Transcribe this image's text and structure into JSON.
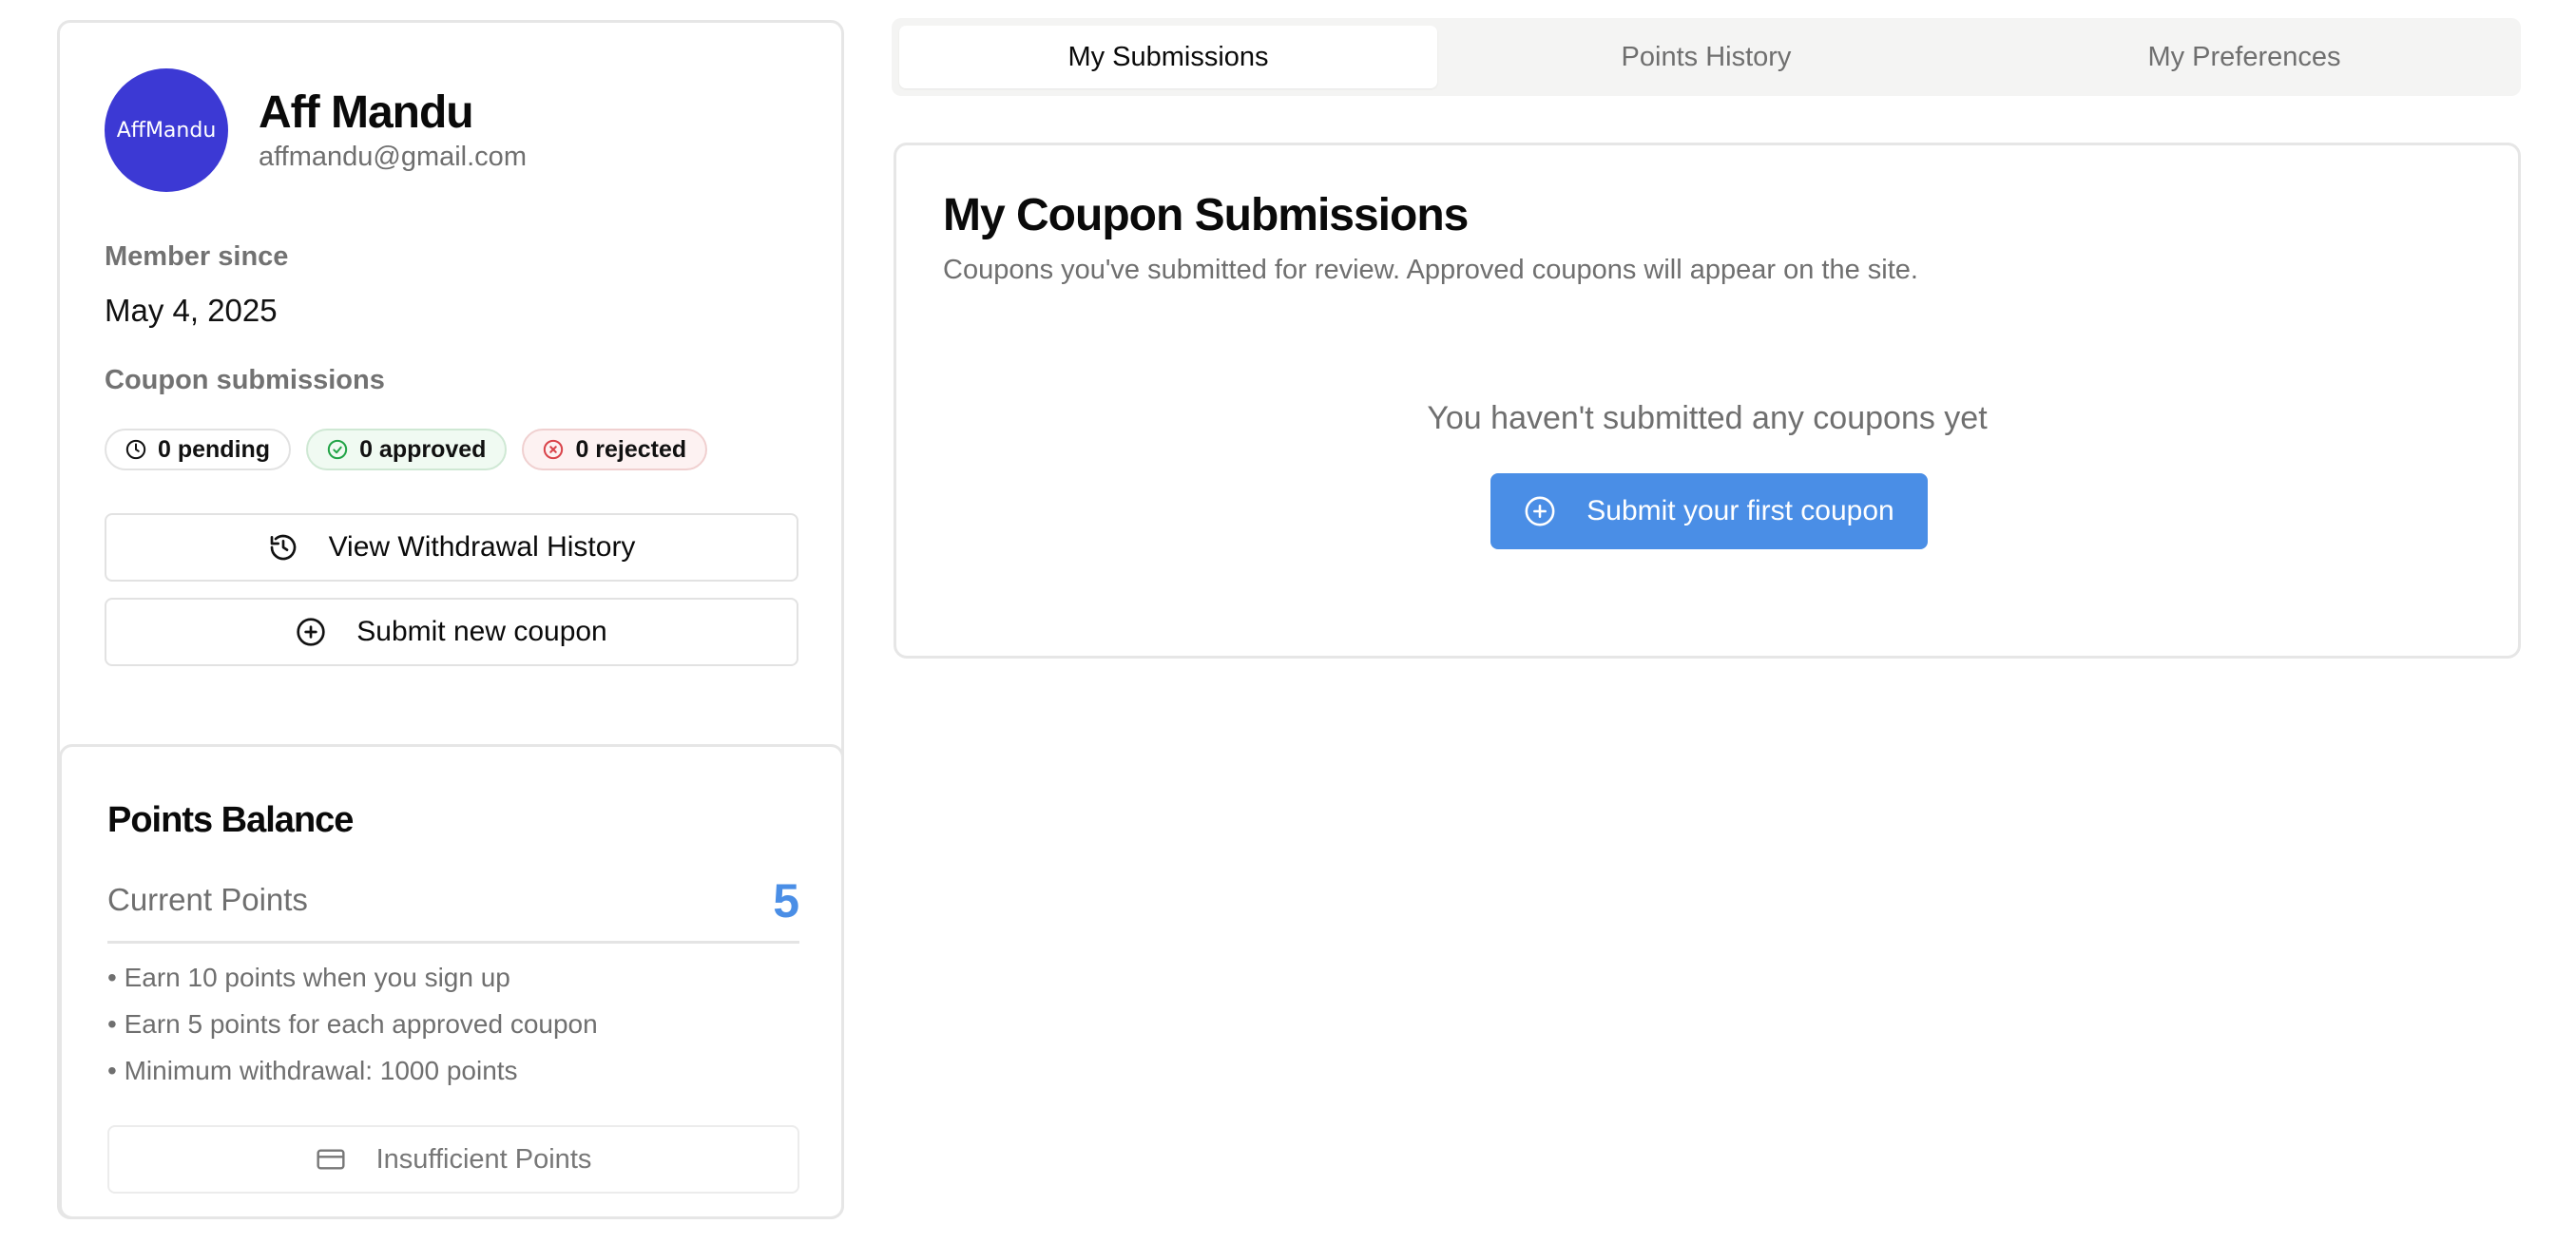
{
  "profile": {
    "avatar_text": "AffMandu",
    "name": "Aff Mandu",
    "email": "affmandu@gmail.com",
    "member_since_label": "Member since",
    "member_since_value": "May 4, 2025",
    "coupon_submissions_label": "Coupon submissions",
    "badges": {
      "pending": "0 pending",
      "approved": "0 approved",
      "rejected": "0 rejected"
    },
    "buttons": {
      "withdrawal_history": "View Withdrawal History",
      "submit_new_coupon": "Submit new coupon"
    },
    "icons": {
      "pending": "clock-icon",
      "approved": "check-circle-icon",
      "rejected": "x-circle-icon",
      "withdrawal_history": "history-icon",
      "submit_new_coupon": "plus-circle-icon"
    }
  },
  "points": {
    "title": "Points Balance",
    "current_label": "Current Points",
    "current_value": "5",
    "rules": [
      "• Earn 10 points when you sign up",
      "• Earn 5 points for each approved coupon",
      "• Minimum withdrawal: 1000 points"
    ],
    "withdraw_button": "Insufficient Points",
    "withdraw_icon": "credit-card-icon"
  },
  "tabs": [
    {
      "label": "My Submissions",
      "active": true
    },
    {
      "label": "Points History",
      "active": false
    },
    {
      "label": "My Preferences",
      "active": false
    }
  ],
  "submissions": {
    "title": "My Coupon Submissions",
    "description": "Coupons you've submitted for review. Approved coupons will appear on the site.",
    "empty_text": "You haven't submitted any coupons yet",
    "first_button": "Submit your first coupon",
    "first_button_icon": "plus-circle-icon"
  },
  "colors": {
    "accent": "#4a8ee6",
    "avatar_bg": "#3c39d4",
    "approved_green": "#22a447",
    "rejected_red": "#d9434a"
  }
}
